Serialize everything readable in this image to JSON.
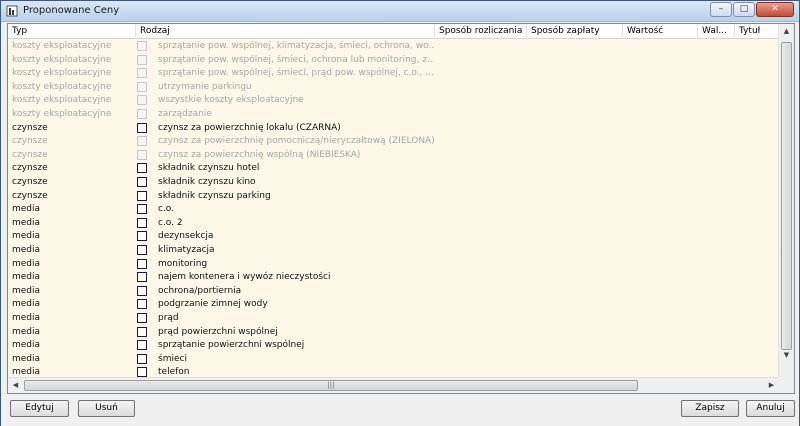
{
  "window": {
    "title": "Proponowane Ceny"
  },
  "columns": [
    "Typ",
    "Rodzaj",
    "Sposób rozliczania",
    "Sposób zapłaty",
    "Wartość",
    "Wal...",
    "Tytuł"
  ],
  "rows": [
    {
      "typ": "koszty eksploatacyjne",
      "rodzaj": "sprzątanie pow. wspólnej, klimatyzacja, śmieci, ochrona, wo...",
      "enabled": false
    },
    {
      "typ": "koszty eksploatacyjne",
      "rodzaj": "sprzątanie pow. wspólnej, śmieci, ochrona lub monitoring, z...",
      "enabled": false
    },
    {
      "typ": "koszty eksploatacyjne",
      "rodzaj": "sprzątanie pow. wspólnej, śmieci, prąd pow. wspólnej, c.o., ...",
      "enabled": false
    },
    {
      "typ": "koszty eksploatacyjne",
      "rodzaj": "utrzymanie parkingu",
      "enabled": false
    },
    {
      "typ": "koszty eksploatacyjne",
      "rodzaj": "wszystkie koszty eksploatacyjne",
      "enabled": false
    },
    {
      "typ": "koszty eksploatacyjne",
      "rodzaj": "zarządzanie",
      "enabled": false
    },
    {
      "typ": "czynsze",
      "rodzaj": "czynsz za powierzchnię lokalu (CZARNA)",
      "enabled": true
    },
    {
      "typ": "czynsze",
      "rodzaj": "czynsz za powierzchnię pomocniczą/nieryczałtową (ZIELONA)",
      "enabled": false
    },
    {
      "typ": "czynsze",
      "rodzaj": "czynsz za powierzchnię wspólną (NIEBIESKA)",
      "enabled": false
    },
    {
      "typ": "czynsze",
      "rodzaj": "składnik czynszu hotel",
      "enabled": true
    },
    {
      "typ": "czynsze",
      "rodzaj": "składnik czynszu kino",
      "enabled": true
    },
    {
      "typ": "czynsze",
      "rodzaj": "składnik czynszu parking",
      "enabled": true
    },
    {
      "typ": "media",
      "rodzaj": "c.o.",
      "enabled": true
    },
    {
      "typ": "media",
      "rodzaj": "c.o. 2",
      "enabled": true
    },
    {
      "typ": "media",
      "rodzaj": "dezynsekcja",
      "enabled": true
    },
    {
      "typ": "media",
      "rodzaj": "klimatyzacja",
      "enabled": true
    },
    {
      "typ": "media",
      "rodzaj": "monitoring",
      "enabled": true
    },
    {
      "typ": "media",
      "rodzaj": "najem kontenera i wywóz nieczystości",
      "enabled": true
    },
    {
      "typ": "media",
      "rodzaj": "ochrona/portiernia",
      "enabled": true
    },
    {
      "typ": "media",
      "rodzaj": "podgrzanie zimnej wody",
      "enabled": true
    },
    {
      "typ": "media",
      "rodzaj": "prąd",
      "enabled": true
    },
    {
      "typ": "media",
      "rodzaj": "prąd powierzchni wspólnej",
      "enabled": true
    },
    {
      "typ": "media",
      "rodzaj": "sprzątanie powierzchni wspólnej",
      "enabled": true
    },
    {
      "typ": "media",
      "rodzaj": "śmieci",
      "enabled": true
    },
    {
      "typ": "media",
      "rodzaj": "telefon",
      "enabled": true
    }
  ],
  "buttons": {
    "edit": "Edytuj",
    "delete": "Usuń",
    "save": "Zapisz",
    "cancel": "Anuluj"
  },
  "window_buttons": {
    "minimize": "–",
    "maximize": "□",
    "close": "✕"
  },
  "scrollbar": {
    "grip": "|||",
    "up": "▲",
    "down": "▼",
    "left": "◀",
    "right": "▶"
  },
  "colors": {
    "row_background": "#fdf8e8",
    "disabled_text": "#a6a6a6",
    "enabled_text": "#111111"
  }
}
